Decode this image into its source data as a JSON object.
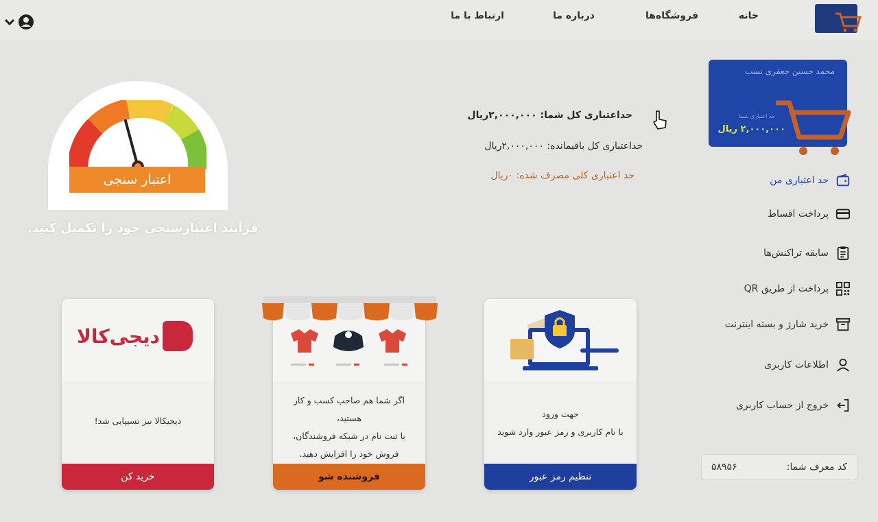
{
  "nav": {
    "home": "خانه",
    "stores": "فروشگاه‌ها",
    "about": "درباره ما",
    "contact": "ارتباط با ما"
  },
  "card": {
    "holder_name": "محمد حسین جعفری نسب",
    "limit_label": "حد اعتباری شما",
    "limit_value": "۲,۰۰۰,۰۰۰ ریال"
  },
  "sidebar": {
    "items": [
      {
        "label": "حد اعتباری من",
        "icon": "wallet-icon"
      },
      {
        "label": "پرداخت اقساط",
        "icon": "credit-card-icon"
      },
      {
        "label": "سابقه تراکنش‌ها",
        "icon": "clipboard-icon"
      },
      {
        "label": "پرداخت از طریق QR",
        "icon": "qr-code-icon"
      },
      {
        "label": "خرید شارژ و بسته اینترنت",
        "icon": "archive-box-icon"
      },
      {
        "label": "اطلاعات کاربری",
        "icon": "user-icon"
      },
      {
        "label": "خروج از حساب کاربری",
        "icon": "logout-icon"
      }
    ]
  },
  "referral": {
    "label": "کد معرف شما:",
    "code": "۵۸۹۵۶"
  },
  "credit": {
    "total": "حداعتباری کل شما: ۲,۰۰۰,۰۰۰ریال",
    "remaining": "حداعتباری کل باقیمانده: ۲,۰۰۰,۰۰۰ریال",
    "used": "حد اعتباری کلی مصرف شده: ۰ریال"
  },
  "gauge": {
    "label": "اعتبار سنجی",
    "caption": "فرآیند اعتبارسنجی خود را تکمیل کنید."
  },
  "promos": {
    "digikala": {
      "logo_text": "دیجی‌کالا",
      "text": "دیجیکالا نیز نسیپایی شد!",
      "button": "خرید کن",
      "button_color": "#c8273c"
    },
    "seller": {
      "lines": [
        "اگر شما هم صاحب کسب و کار هستید،",
        "با ثبت نام در شبکه فروشندگان،",
        "فروش خود را افزایش دهید."
      ],
      "button": "فروشنده شو",
      "button_color": "#d96a1f"
    },
    "login": {
      "lines": [
        "جهت ورود",
        "با نام کاربری و رمز عبور  وارد شوید"
      ],
      "button": "تنظیم رمز عبور",
      "button_color": "#1f3f9e"
    }
  },
  "colors": {
    "brand_blue": "#1f45a8",
    "accent_orange": "#ef8a2a",
    "used_text": "#b8662a"
  }
}
